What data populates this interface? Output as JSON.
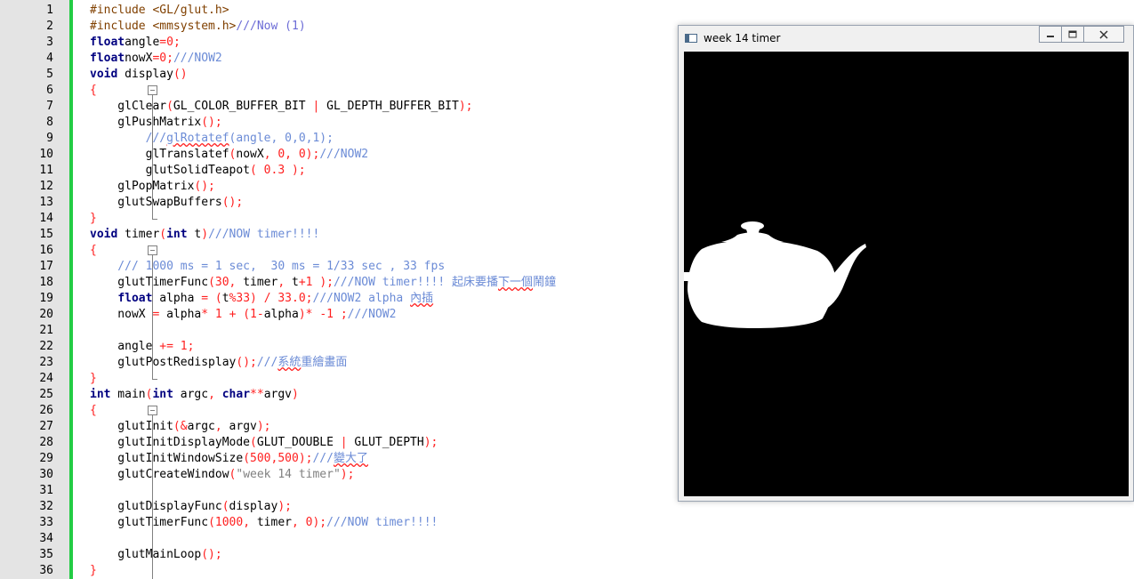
{
  "editor": {
    "lines": [
      {
        "n": "1",
        "t": [
          [
            "pp",
            "#include <GL/glut.h>"
          ]
        ]
      },
      {
        "n": "2",
        "t": [
          [
            "pp",
            "#include <mmsystem.h>"
          ],
          [
            "cmc",
            "///Now (1)"
          ]
        ]
      },
      {
        "n": "3",
        "t": [
          [
            "kw",
            "float"
          ],
          [
            "",
            "angle"
          ],
          [
            "op",
            "="
          ],
          [
            "nm",
            "0"
          ],
          [
            "op",
            ";"
          ]
        ]
      },
      {
        "n": "4",
        "t": [
          [
            "kw",
            "float"
          ],
          [
            "",
            "nowX"
          ],
          [
            "op",
            "="
          ],
          [
            "nm",
            "0"
          ],
          [
            "op",
            ";"
          ],
          [
            "cm",
            "///NOW2"
          ]
        ]
      },
      {
        "n": "5",
        "t": [
          [
            "kw",
            "void"
          ],
          [
            "",
            " display"
          ],
          [
            "op",
            "()"
          ]
        ]
      },
      {
        "n": "6",
        "t": [
          [
            "op",
            "{"
          ]
        ]
      },
      {
        "n": "7",
        "t": [
          [
            "",
            "    glClear"
          ],
          [
            "op",
            "("
          ],
          [
            "",
            "GL_COLOR_BUFFER_BIT "
          ],
          [
            "op",
            "|"
          ],
          [
            "",
            " GL_DEPTH_BUFFER_BIT"
          ],
          [
            "op",
            ");"
          ]
        ]
      },
      {
        "n": "8",
        "t": [
          [
            "",
            "    glPushMatrix"
          ],
          [
            "op",
            "();"
          ]
        ]
      },
      {
        "n": "9",
        "t": [
          [
            "cm",
            "        ///"
          ],
          [
            "cm sq",
            "glRotatef"
          ],
          [
            "cm",
            "(angle, 0,0,1);"
          ]
        ]
      },
      {
        "n": "10",
        "t": [
          [
            "",
            "        glTranslatef"
          ],
          [
            "op",
            "("
          ],
          [
            "",
            "nowX"
          ],
          [
            "op",
            ","
          ],
          [
            "",
            " "
          ],
          [
            "nm",
            "0"
          ],
          [
            "op",
            ","
          ],
          [
            "",
            " "
          ],
          [
            "nm",
            "0"
          ],
          [
            "op",
            ");"
          ],
          [
            "cm",
            "///NOW2"
          ]
        ]
      },
      {
        "n": "11",
        "t": [
          [
            "",
            "        glutSolidTeapot"
          ],
          [
            "op",
            "("
          ],
          [
            "",
            " "
          ],
          [
            "nm",
            "0.3"
          ],
          [
            "",
            " "
          ],
          [
            "op",
            ");"
          ]
        ]
      },
      {
        "n": "12",
        "t": [
          [
            "",
            "    glPopMatrix"
          ],
          [
            "op",
            "();"
          ]
        ]
      },
      {
        "n": "13",
        "t": [
          [
            "",
            "    glutSwapBuffers"
          ],
          [
            "op",
            "();"
          ]
        ]
      },
      {
        "n": "14",
        "t": [
          [
            "op",
            "}"
          ]
        ]
      },
      {
        "n": "15",
        "t": [
          [
            "kw",
            "void"
          ],
          [
            "",
            " timer"
          ],
          [
            "op",
            "("
          ],
          [
            "kw",
            "int"
          ],
          [
            "",
            " t"
          ],
          [
            "op",
            ")"
          ],
          [
            "cm",
            "///NOW timer!!!!"
          ]
        ]
      },
      {
        "n": "16",
        "t": [
          [
            "op",
            "{"
          ]
        ]
      },
      {
        "n": "17",
        "t": [
          [
            "cm",
            "    /// 1000 ms = 1 sec,  30 ms = 1/33 sec , 33 fps"
          ]
        ]
      },
      {
        "n": "18",
        "t": [
          [
            "",
            "    glutTimerFunc"
          ],
          [
            "op",
            "("
          ],
          [
            "nm",
            "30"
          ],
          [
            "op",
            ","
          ],
          [
            "",
            " timer"
          ],
          [
            "op",
            ","
          ],
          [
            "",
            " t"
          ],
          [
            "op",
            "+"
          ],
          [
            "nm",
            "1"
          ],
          [
            "",
            " "
          ],
          [
            "op",
            ");"
          ],
          [
            "cm",
            "///NOW timer!!!! "
          ],
          [
            "cm",
            "起床要播"
          ],
          [
            "cm sq",
            "下一個"
          ],
          [
            "cm",
            "鬧鐘"
          ]
        ]
      },
      {
        "n": "19",
        "t": [
          [
            "",
            "    "
          ],
          [
            "kw",
            "float"
          ],
          [
            "",
            " alpha "
          ],
          [
            "op",
            "="
          ],
          [
            "",
            " "
          ],
          [
            "op",
            "("
          ],
          [
            "",
            "t"
          ],
          [
            "op",
            "%"
          ],
          [
            "nm",
            "33"
          ],
          [
            "op",
            ")"
          ],
          [
            "",
            " "
          ],
          [
            "op",
            "/"
          ],
          [
            "",
            " "
          ],
          [
            "nm",
            "33.0"
          ],
          [
            "op",
            ";"
          ],
          [
            "cm",
            "///NOW2 alpha "
          ],
          [
            "cm sq",
            "內插"
          ]
        ]
      },
      {
        "n": "20",
        "t": [
          [
            "",
            "    nowX "
          ],
          [
            "op",
            "="
          ],
          [
            "",
            " alpha"
          ],
          [
            "op",
            "*"
          ],
          [
            "",
            " "
          ],
          [
            "nm",
            "1"
          ],
          [
            "",
            " "
          ],
          [
            "op",
            "+"
          ],
          [
            "",
            " "
          ],
          [
            "op",
            "("
          ],
          [
            "nm",
            "1"
          ],
          [
            "op",
            "-"
          ],
          [
            "",
            "alpha"
          ],
          [
            "op",
            ")*"
          ],
          [
            "",
            " "
          ],
          [
            "op",
            "-"
          ],
          [
            "nm",
            "1"
          ],
          [
            "",
            " "
          ],
          [
            "op",
            ";"
          ],
          [
            "cm",
            "///NOW2"
          ]
        ]
      },
      {
        "n": "21",
        "t": []
      },
      {
        "n": "22",
        "t": [
          [
            "",
            "    angle "
          ],
          [
            "op",
            "+="
          ],
          [
            "",
            " "
          ],
          [
            "nm",
            "1"
          ],
          [
            "op",
            ";"
          ]
        ]
      },
      {
        "n": "23",
        "t": [
          [
            "",
            "    glutPostRedisplay"
          ],
          [
            "op",
            "();"
          ],
          [
            "cm",
            "///"
          ],
          [
            "cm sq",
            "系統"
          ],
          [
            "cm",
            "重繪畫面"
          ]
        ]
      },
      {
        "n": "24",
        "t": [
          [
            "op",
            "}"
          ]
        ]
      },
      {
        "n": "25",
        "t": [
          [
            "kw",
            "int"
          ],
          [
            "",
            " main"
          ],
          [
            "op",
            "("
          ],
          [
            "kw",
            "int"
          ],
          [
            "",
            " argc"
          ],
          [
            "op",
            ","
          ],
          [
            "",
            " "
          ],
          [
            "kw",
            "char"
          ],
          [
            "op",
            "**"
          ],
          [
            "",
            "argv"
          ],
          [
            "op",
            ")"
          ]
        ]
      },
      {
        "n": "26",
        "t": [
          [
            "op",
            "{"
          ]
        ]
      },
      {
        "n": "27",
        "t": [
          [
            "",
            "    glutInit"
          ],
          [
            "op",
            "(&"
          ],
          [
            "",
            "argc"
          ],
          [
            "op",
            ","
          ],
          [
            "",
            " argv"
          ],
          [
            "op",
            ");"
          ]
        ]
      },
      {
        "n": "28",
        "t": [
          [
            "",
            "    glutInitDisplayMode"
          ],
          [
            "op",
            "("
          ],
          [
            "",
            "GLUT_DOUBLE "
          ],
          [
            "op",
            "|"
          ],
          [
            "",
            " GLUT_DEPTH"
          ],
          [
            "op",
            ");"
          ]
        ]
      },
      {
        "n": "29",
        "t": [
          [
            "",
            "    glutInitWindowSize"
          ],
          [
            "op",
            "("
          ],
          [
            "nm",
            "500"
          ],
          [
            "op",
            ","
          ],
          [
            "nm",
            "500"
          ],
          [
            "op",
            ");"
          ],
          [
            "cm",
            "///"
          ],
          [
            "cm sq",
            "變大了"
          ]
        ]
      },
      {
        "n": "30",
        "t": [
          [
            "",
            "    glutCreateWindow"
          ],
          [
            "op",
            "("
          ],
          [
            "st",
            "\"week 14 timer\""
          ],
          [
            "op",
            ");"
          ]
        ]
      },
      {
        "n": "31",
        "t": []
      },
      {
        "n": "32",
        "t": [
          [
            "",
            "    glutDisplayFunc"
          ],
          [
            "op",
            "("
          ],
          [
            "",
            "display"
          ],
          [
            "op",
            ");"
          ]
        ]
      },
      {
        "n": "33",
        "t": [
          [
            "",
            "    glutTimerFunc"
          ],
          [
            "op",
            "("
          ],
          [
            "nm",
            "1000"
          ],
          [
            "op",
            ","
          ],
          [
            "",
            " timer"
          ],
          [
            "op",
            ","
          ],
          [
            "",
            " "
          ],
          [
            "nm",
            "0"
          ],
          [
            "op",
            ");"
          ],
          [
            "cm",
            "///NOW timer!!!!"
          ]
        ]
      },
      {
        "n": "34",
        "t": []
      },
      {
        "n": "35",
        "t": [
          [
            "",
            "    glutMainLoop"
          ],
          [
            "op",
            "();"
          ]
        ]
      },
      {
        "n": "36",
        "t": [
          [
            "op",
            "}"
          ]
        ]
      }
    ]
  },
  "glut_window": {
    "title": "week 14 timer",
    "minimize_icon": "minimize-icon",
    "maximize_icon": "maximize-icon",
    "close_icon": "close-icon",
    "content_icon": "teapot-icon",
    "canvas_bg": "#000000",
    "teapot_color": "#ffffff"
  },
  "colors": {
    "keyword": "#000080",
    "preprocessor": "#804000",
    "comment": "#6b8bd6",
    "number": "#ff2020",
    "change_bar": "#22cc44"
  }
}
